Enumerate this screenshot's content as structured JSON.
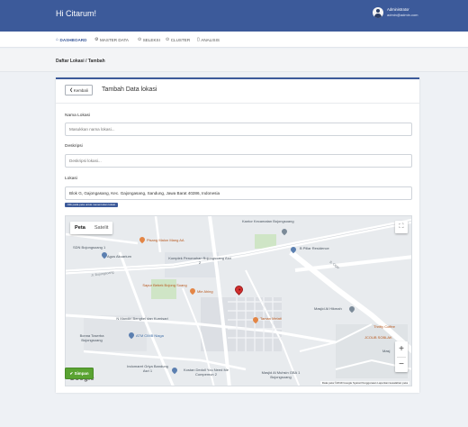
{
  "header": {
    "greeting": "Hi Citarum!",
    "user_name": "Administrator",
    "user_email": "admin@admin.com"
  },
  "nav": [
    {
      "label": "DASHBOARD",
      "icon": "home-icon"
    },
    {
      "label": "MASTER DATA",
      "icon": "gear-icon"
    },
    {
      "label": "SELEKSI",
      "icon": "map-pin-icon"
    },
    {
      "label": "CLUSTER",
      "icon": "map-pin-icon"
    },
    {
      "label": "ANALISIS",
      "icon": "document-icon"
    }
  ],
  "breadcrumb": "Daftar Lokasi / Tambah",
  "form": {
    "back_label": "Kembali",
    "title": "Tambah Data lokasi",
    "name_label": "Nama Lokasi",
    "name_placeholder": "Masukkan nama lokasi...",
    "desc_label": "Deskripsi",
    "desc_placeholder": "Deskripsi lokasi...",
    "location_label": "Lokasi",
    "location_value": "Blok G, Gajongasang, Kec. Gajongasang, Sandung, Jawa Barat 40286, Indonesia",
    "location_hint": "Klik pada peta untuk menentukan lokasi",
    "save_label": "Simpan"
  },
  "map": {
    "type_map": "Peta",
    "type_satellite": "Satelit",
    "zoom_in": "+",
    "zoom_out": "−",
    "logo": "Google",
    "attribution": "Data peta ©2019 Google   Syarat Penggunaan   Laporkan kesalahan peta",
    "places": {
      "kantor": "Kantor Kecamatan Bojongsoang",
      "pisang": "Pisang Malon Mang AA",
      "sdn": "SDN Bojongsoang 1",
      "agus": "Agus Akuarium",
      "komplek": "Komplek Perumahan Bojongsoang Asri 2",
      "bpillar": "B Pillar Residence",
      "sapur": "Sapur Bebek Bojong Soang",
      "mie": "Mie Ahing",
      "mandiri": "N Mandiri Bengkel dan Kurnisari",
      "atm": "ATM CIMB Niaga",
      "bonna": "Bonna Toserba Bojongsoang",
      "tamanmelati": "Taman Melati",
      "indomaret": "Indomaret Griya Bandung Asri 1",
      "kostan": "Kostan Dedoll You Need Me Compemun 2",
      "masjid1": "Masjid Al Hikmah",
      "masjid2": "Masjid Al Muhsin GBA 1 Bojongsoang",
      "thrifty": "Thrifty Coffee",
      "jcoob": "JCOUB SOBLAK",
      "masjid3": "Masj"
    },
    "roads": {
      "bojongsoang": "Jl. Bojongsoang",
      "ciganitri": "Jl. Cigar"
    }
  }
}
